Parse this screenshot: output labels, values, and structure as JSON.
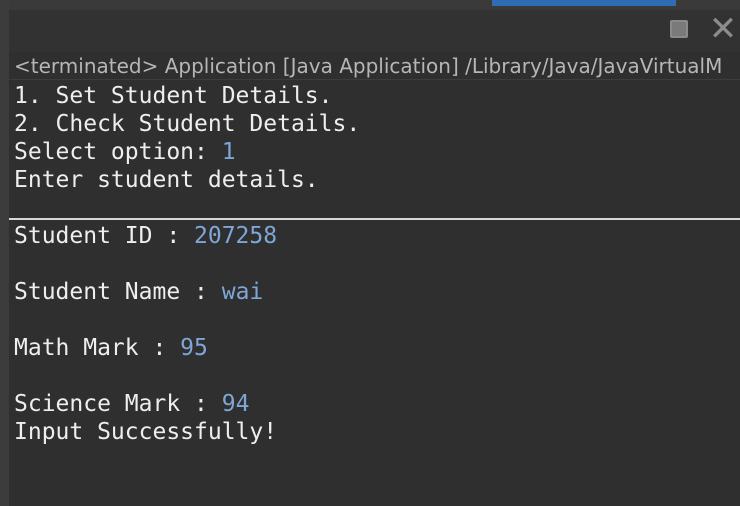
{
  "window": {
    "status_text": "<terminated> Application [Java Application] /Library/Java/JavaVirtualM"
  },
  "console": {
    "menu_line_1": "1. Set Student Details.",
    "menu_line_2": "2. Check Student Details.",
    "select_prompt": "Select option: ",
    "select_value": "1",
    "enter_prompt": "Enter student details.",
    "id_prompt": "Student ID : ",
    "id_value": "207258",
    "name_prompt": "Student Name : ",
    "name_value": "wai",
    "math_prompt": "Math Mark : ",
    "math_value": "95",
    "science_prompt": "Science Mark : ",
    "science_value": "94",
    "success_message": "Input Successfully!"
  },
  "colors": {
    "background": "#2f2f2f",
    "output_text": "#eeeeee",
    "input_text": "#7ea6d6",
    "active_tab": "#2f6db3"
  }
}
